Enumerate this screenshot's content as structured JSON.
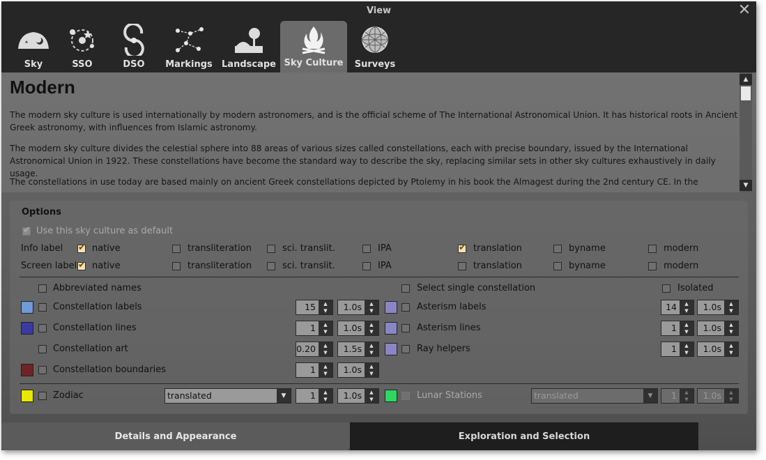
{
  "window": {
    "title": "View",
    "close_label": "✕"
  },
  "tabs": [
    {
      "label": "Sky",
      "icon": "sky-icon"
    },
    {
      "label": "SSO",
      "icon": "sso-icon"
    },
    {
      "label": "DSO",
      "icon": "dso-icon"
    },
    {
      "label": "Markings",
      "icon": "markings-icon"
    },
    {
      "label": "Landscape",
      "icon": "landscape-icon"
    },
    {
      "label": "Sky Culture",
      "icon": "sky-culture-icon",
      "active": true
    },
    {
      "label": "Surveys",
      "icon": "surveys-icon"
    }
  ],
  "description": {
    "title": "Modern",
    "paragraphs": [
      "The modern sky culture is used internationally by modern astronomers, and is the official scheme of The International Astronomical Union. It has historical roots in Ancient Greek astronomy, with influences from Islamic astronomy.",
      "The modern sky culture divides the celestial sphere into 88 areas of various sizes called constellations, each with precise boundary, issued by the International Astronomical Union in 1922. These constellations have become the standard way to describe the sky, replacing similar sets in other sky cultures exhaustively in daily usage.",
      "The constellations in use today are based mainly on ancient Greek constellations depicted by Ptolemy in his book the Almagest during the 2nd century CE. In the"
    ]
  },
  "options": {
    "title": "Options",
    "use_default": {
      "label": "Use this sky culture as default",
      "checked": true
    },
    "name_columns": [
      "native",
      "transliteration",
      "sci. translit.",
      "IPA",
      "translation",
      "byname",
      "modern"
    ],
    "info_label": {
      "label": "Info label",
      "checked": [
        true,
        false,
        false,
        false,
        true,
        false,
        false
      ]
    },
    "screen_label": {
      "label": "Screen label",
      "checked": [
        true,
        false,
        false,
        false,
        false,
        false,
        false
      ]
    },
    "abbreviated_names": "Abbreviated names",
    "select_single": "Select single constellation",
    "isolated": "Isolated",
    "constellation_labels": {
      "label": "Constellation labels",
      "color": "#6f9ad6",
      "size": "15",
      "fade": "1.0s"
    },
    "constellation_lines": {
      "label": "Constellation lines",
      "color": "#3a3aa0",
      "width": "1",
      "fade": "1.0s"
    },
    "constellation_art": {
      "label": "Constellation art",
      "intensity": "0.20",
      "fade": "1.5s"
    },
    "constellation_boundaries": {
      "label": "Constellation boundaries",
      "color": "#6e2424",
      "width": "1",
      "fade": "1.0s"
    },
    "asterism_labels": {
      "label": "Asterism labels",
      "color": "#8a86c4",
      "size": "14",
      "fade": "1.0s"
    },
    "asterism_lines": {
      "label": "Asterism lines",
      "color": "#8a86c4",
      "width": "1",
      "fade": "1.0s"
    },
    "ray_helpers": {
      "label": "Ray helpers",
      "color": "#8a86c4",
      "width": "1",
      "fade": "1.0s"
    },
    "zodiac": {
      "label": "Zodiac",
      "color": "#e8e800",
      "mode": "translated",
      "width": "1",
      "fade": "1.0s"
    },
    "lunar_stations": {
      "label": "Lunar Stations",
      "color": "#2ed860",
      "mode": "translated",
      "width": "1",
      "fade": "1.0s"
    }
  },
  "bottom_tabs": {
    "details": "Details and Appearance",
    "exploration": "Exploration and Selection"
  }
}
